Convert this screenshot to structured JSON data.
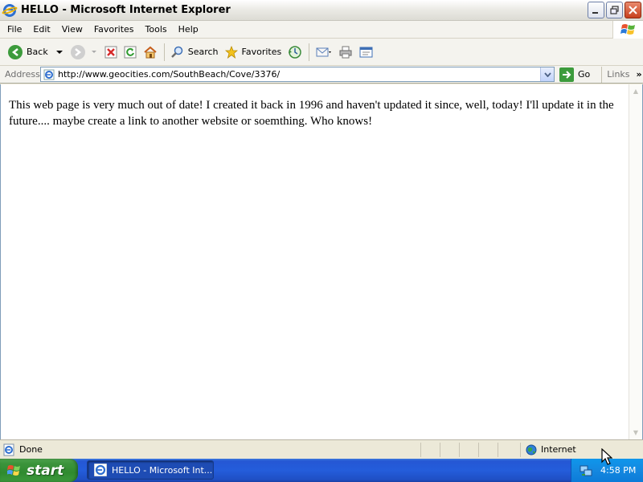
{
  "window": {
    "title": "HELLO - Microsoft Internet Explorer"
  },
  "menu": {
    "items": [
      "File",
      "Edit",
      "View",
      "Favorites",
      "Tools",
      "Help"
    ]
  },
  "toolbar": {
    "back_label": "Back",
    "search_label": "Search",
    "favorites_label": "Favorites"
  },
  "address": {
    "label": "Address",
    "url": "http://www.geocities.com/SouthBeach/Cove/3376/",
    "go_label": "Go",
    "links_label": "Links"
  },
  "page": {
    "body_text": "This web page is very much out of date! I created it back in 1996 and haven't updated it since, well, today! I'll update it in the future.... maybe create a link to another website or soemthing. Who knows!"
  },
  "status": {
    "text": "Done",
    "zone": "Internet"
  },
  "taskbar": {
    "start_label": "start",
    "task_label": "HELLO - Microsoft Int...",
    "clock": "4:58 PM"
  }
}
